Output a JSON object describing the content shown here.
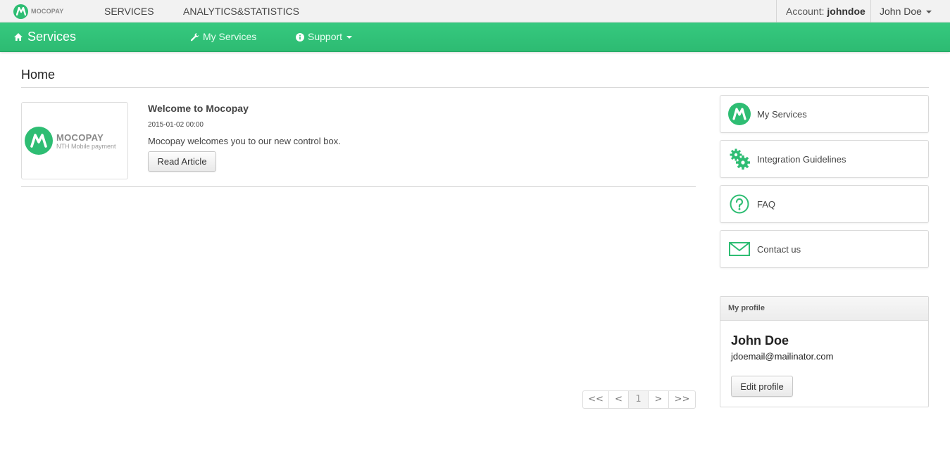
{
  "topbar": {
    "brand_name": "MOCOPAY",
    "nav": [
      "SERVICES",
      "ANALYTICS&STATISTICS"
    ],
    "account_label": "Account:",
    "account_value": "johndoe",
    "user_menu": "John Doe"
  },
  "navbar": {
    "brand": "Services",
    "items": [
      {
        "label": "My Services",
        "icon": "wrench-icon"
      },
      {
        "label": "Support",
        "icon": "info-icon"
      }
    ]
  },
  "page": {
    "title": "Home"
  },
  "article": {
    "thumb_name": "MOCOPAY",
    "thumb_sub": "NTH Mobile payment",
    "title": "Welcome to Mocopay",
    "date": "2015-01-02 00:00",
    "text": "Mocopay welcomes you to our new control box.",
    "button": "Read Article"
  },
  "pagination": {
    "first": "<<",
    "prev": "<",
    "current": "1",
    "next": ">",
    "last": ">>"
  },
  "side_links": [
    {
      "label": "My Services",
      "icon": "mocopay-logo-icon"
    },
    {
      "label": "Integration Guidelines",
      "icon": "gears-icon"
    },
    {
      "label": "FAQ",
      "icon": "question-icon"
    },
    {
      "label": "Contact us",
      "icon": "envelope-icon"
    }
  ],
  "profile": {
    "heading": "My profile",
    "name": "John Doe",
    "email": "jdoemail@mailinator.com",
    "edit_button": "Edit profile"
  },
  "colors": {
    "brand_green": "#2ebd73",
    "topbar_bg": "#f2f2f2"
  }
}
